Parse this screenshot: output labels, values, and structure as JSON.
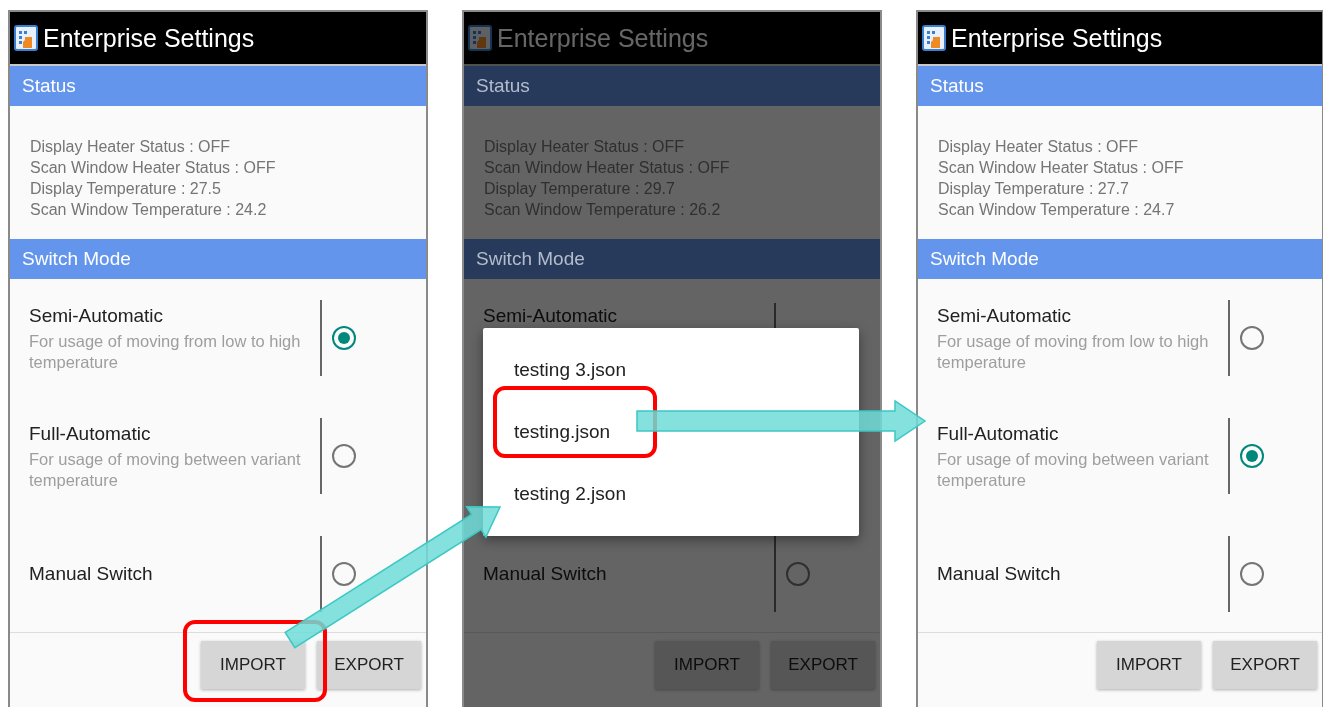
{
  "panels": [
    {
      "title": "Enterprise Settings",
      "dimmed": false,
      "status_header": "Status",
      "status_lines": [
        "Display Heater Status : OFF",
        "Scan Window Heater Status : OFF",
        "Display Temperature : 27.5",
        "Scan Window Temperature : 24.2"
      ],
      "mode_header": "Switch Mode",
      "options": [
        {
          "title": "Semi-Automatic",
          "description": "For usage of moving from low to high temperature",
          "selected": true
        },
        {
          "title": "Full-Automatic",
          "description": "For usage of moving between variant temperature",
          "selected": false
        },
        {
          "title": "Manual Switch",
          "selected": false
        }
      ],
      "buttons": [
        "IMPORT",
        "EXPORT"
      ]
    },
    {
      "title": "Enterprise Settings",
      "dimmed": true,
      "status_header": "Status",
      "status_lines": [
        "Display Heater Status : OFF",
        "Scan Window Heater Status : OFF",
        "Display Temperature : 29.7",
        "Scan Window Temperature : 26.2"
      ],
      "mode_header": "Switch Mode",
      "options": [
        {
          "title": "Semi-Automatic"
        },
        {
          "title": "Manual Switch",
          "selected": false
        }
      ],
      "buttons": [
        "IMPORT",
        "EXPORT"
      ],
      "dialog": {
        "items": [
          "testing 3.json",
          "testing.json",
          "testing 2.json"
        ]
      }
    },
    {
      "title": "Enterprise Settings",
      "dimmed": false,
      "status_header": "Status",
      "status_lines": [
        "Display Heater Status : OFF",
        "Scan Window Heater Status : OFF",
        "Display Temperature : 27.7",
        "Scan Window Temperature : 24.7"
      ],
      "mode_header": "Switch Mode",
      "options": [
        {
          "title": "Semi-Automatic",
          "description": "For usage of moving from low to high temperature",
          "selected": false
        },
        {
          "title": "Full-Automatic",
          "description": "For usage of moving between variant temperature",
          "selected": true
        },
        {
          "title": "Manual Switch",
          "selected": false
        }
      ],
      "buttons": [
        "IMPORT",
        "EXPORT"
      ]
    }
  ]
}
